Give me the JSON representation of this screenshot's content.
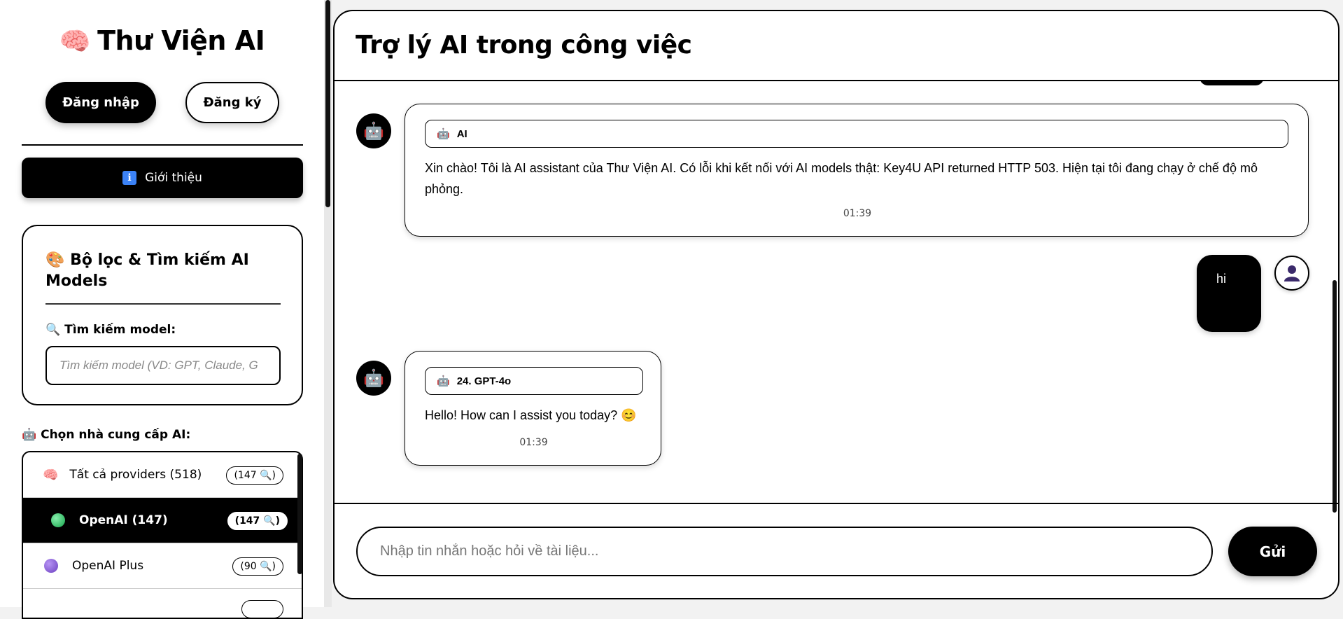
{
  "sidebar": {
    "brand_icon": "🧠",
    "brand_title": "Thư Viện AI",
    "login_label": "Đăng nhập",
    "register_label": "Đăng ký",
    "intro_icon": "ℹ",
    "intro_label": "Giới thiệu",
    "filter": {
      "icon": "🎨",
      "title": "Bộ lọc & Tìm kiếm AI Models",
      "search_icon": "🔍",
      "search_label": "Tìm kiếm model:",
      "search_placeholder": "Tìm kiếm model (VD: GPT, Claude, G",
      "search_value": ""
    },
    "providers_icon": "🤖",
    "providers_label": "Chọn nhà cung cấp AI:",
    "providers": [
      {
        "label": "Tất cả providers (518)",
        "badge": "(147 🔍)",
        "icon": "🧠",
        "color": "#ec4899",
        "active": false
      },
      {
        "label": "OpenAI (147)",
        "badge": "(147 🔍)",
        "icon": "green-dot",
        "color": "#22c55e",
        "active": true
      },
      {
        "label": "OpenAI Plus",
        "badge": "(90 🔍)",
        "icon": "purple-dot",
        "color": "#7c4dcc",
        "active": false
      }
    ]
  },
  "chat": {
    "title": "Trợ lý AI trong công việc",
    "messages": [
      {
        "role": "ai",
        "model": "AI",
        "text": "Xin chào! Tôi là AI assistant của Thư Viện AI. Có lỗi khi kết nối với AI models thật: Key4U API returned HTTP 503. Hiện tại tôi đang chạy ở chế độ mô phỏng.",
        "time": "01:39"
      },
      {
        "role": "user",
        "text": "hi"
      },
      {
        "role": "ai",
        "model": "24. GPT-4o",
        "text": "Hello! How can I assist you today? 😊",
        "time": "01:39"
      }
    ],
    "input_placeholder": "Nhập tin nhắn hoặc hỏi về tài liệu...",
    "input_value": "",
    "send_label": "Gửi",
    "bot_avatar_icon": "🤖",
    "user_avatar_icon": "user-icon"
  }
}
